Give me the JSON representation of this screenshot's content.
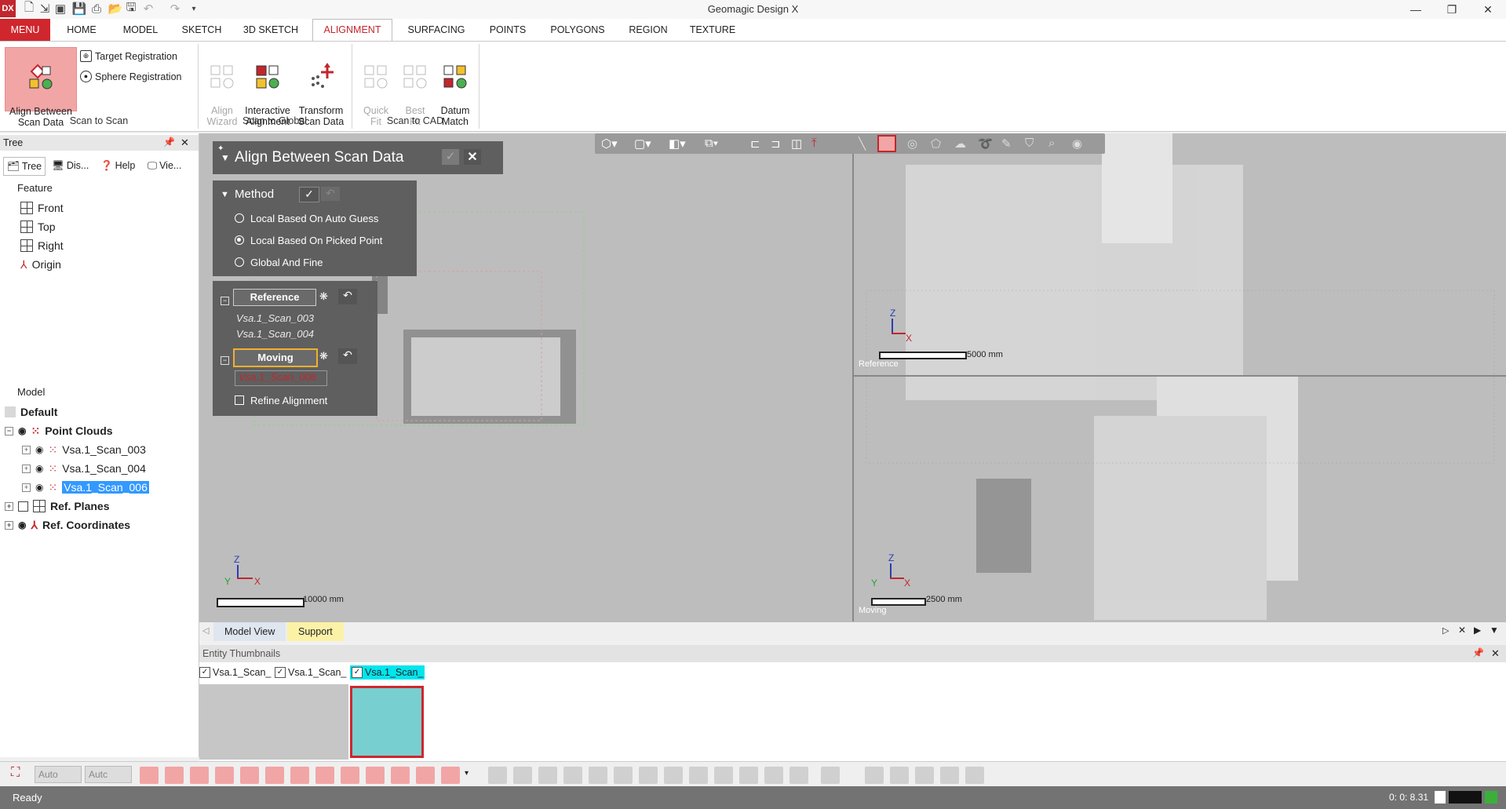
{
  "app": {
    "logo": "DX",
    "title": "Geomagic Design X"
  },
  "menu_tabs": [
    "MENU",
    "HOME",
    "MODEL",
    "SKETCH",
    "3D SKETCH",
    "ALIGNMENT",
    "SURFACING",
    "POINTS",
    "POLYGONS",
    "REGION",
    "TEXTURE"
  ],
  "ribbon": {
    "align_between": "Align Between\nScan Data",
    "target_registration": "Target Registration",
    "sphere_registration": "Sphere Registration",
    "align_wizard": "Align\nWizard",
    "interactive_alignment": "Interactive\nAlignment",
    "transform_scan": "Transform\nScan Data",
    "quick_fit": "Quick\nFit",
    "best_fit": "Best\nFit",
    "datum_match": "Datum\nMatch",
    "groups": [
      "Scan to Scan",
      "Scan to Global",
      "Scan to CAD"
    ]
  },
  "tree_panel": {
    "title": "Tree",
    "tabs": [
      "Tree",
      "Dis...",
      "Help",
      "Vie..."
    ],
    "feature_label": "Feature",
    "features": [
      "Front",
      "Top",
      "Right",
      "Origin"
    ],
    "model_label": "Model",
    "default_label": "Default",
    "point_clouds": "Point Clouds",
    "scans": [
      "Vsa.1_Scan_003",
      "Vsa.1_Scan_004",
      "Vsa.1_Scan_006"
    ],
    "ref_planes": "Ref. Planes",
    "ref_coords": "Ref. Coordinates"
  },
  "dialog": {
    "title": "Align Between Scan Data",
    "method_label": "Method",
    "methods": [
      "Local Based On Auto Guess",
      "Local Based On Picked Point",
      "Global And Fine"
    ],
    "selected_method": 1,
    "reference_label": "Reference",
    "reference_items": [
      "Vsa.1_Scan_003",
      "Vsa.1_Scan_004"
    ],
    "moving_label": "Moving",
    "moving_item": "Vsa.1_Scan_006",
    "refine": "Refine Alignment"
  },
  "viewport": {
    "main_scale": "10000 mm",
    "ref_scale": "5000 mm",
    "moving_scale": "2500 mm",
    "ref_label": "Reference",
    "moving_label": "Moving",
    "axis": {
      "x": "X",
      "y": "Y",
      "z": "Z"
    }
  },
  "view_tabs": [
    "Model View",
    "Support"
  ],
  "thumbnails": {
    "title": "Entity Thumbnails",
    "items": [
      "Vsa.1_Scan_",
      "Vsa.1_Scan_",
      "Vsa.1_Scan_"
    ]
  },
  "bottom_toolbar": {
    "select1": "Auto",
    "select2": "Autc"
  },
  "status": {
    "text": "Ready",
    "time": "0: 0: 8.31"
  },
  "colors": {
    "brand_red": "#c1272d",
    "highlight_pink": "#f2a5a5",
    "viewport_gray": "#bdbdbd",
    "dialog_gray": "#5f5f5f",
    "selection_blue": "#3399ff",
    "thumbnail_cyan": "#78cfd0"
  }
}
